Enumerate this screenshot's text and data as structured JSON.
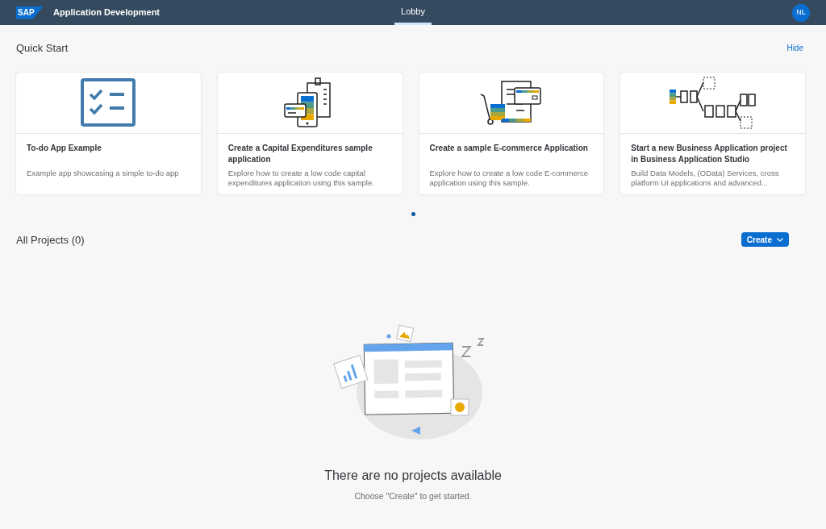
{
  "header": {
    "logo": "SAP",
    "title": "Application Development",
    "tabs": [
      {
        "label": "Lobby",
        "selected": true
      }
    ],
    "avatar": "NL"
  },
  "quick_start": {
    "title": "Quick Start",
    "hide_link": "Hide",
    "cards": [
      {
        "kind": "todo",
        "title": "To-do App Example",
        "description": "Example app showcasing a simple to-do app"
      },
      {
        "kind": "capex",
        "title": "Create a Capital Expenditures sample application",
        "description": "Explore how to create a low code capital expenditures application using this sample."
      },
      {
        "kind": "ecommerce",
        "title": "Create a sample E-commerce Application",
        "description": "Explore how to create a low code E-commerce application using this sample."
      },
      {
        "kind": "process",
        "title": "Start a new Business Application project in Business Application Studio",
        "description": "Build Data Models, (OData) Services, cross platform UI applications and advanced..."
      }
    ],
    "pages": [
      {
        "selected": true
      }
    ]
  },
  "projects": {
    "title": "All Projects (0)",
    "create_button": "Create",
    "empty_title": "There are no projects available",
    "empty_hint": "Choose \"Create\" to get started."
  }
}
